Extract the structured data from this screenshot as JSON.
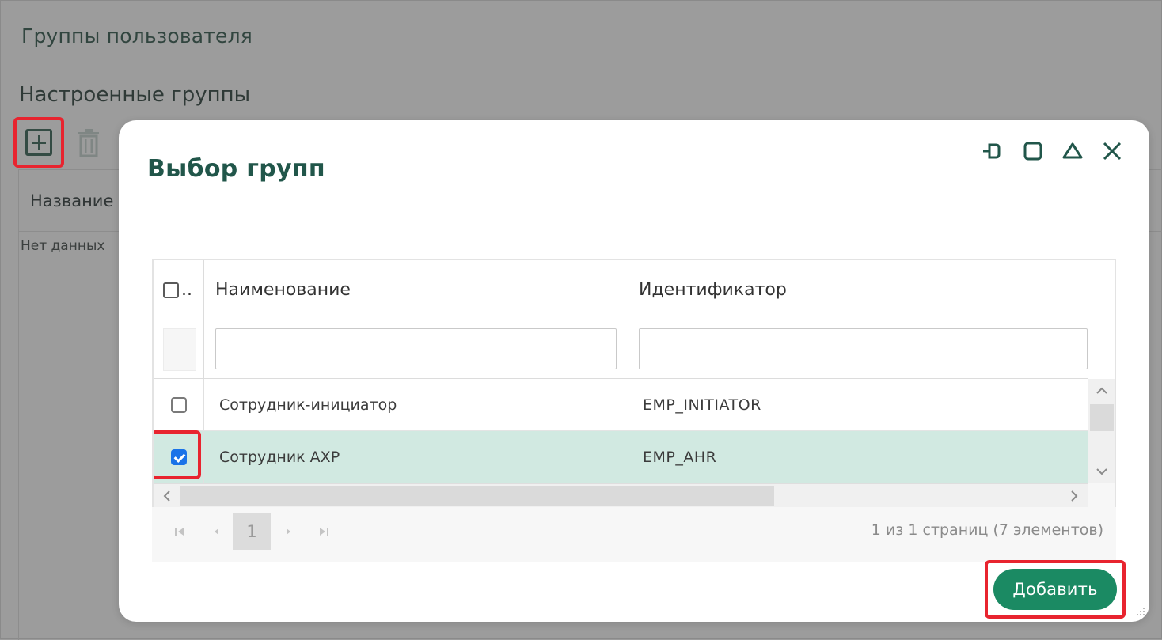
{
  "background": {
    "page_title": "Группы пользователя",
    "section_title": "Настроенные группы",
    "table_header_name": "Название",
    "empty_text": "Нет данных"
  },
  "modal": {
    "title": "Выбор групп",
    "grid": {
      "header_check": "..",
      "columns": {
        "name": "Наименование",
        "id": "Идентификатор"
      },
      "rows": [
        {
          "name": "Сотрудник-инициатор",
          "id": "EMP_INITIATOR",
          "checked": false
        },
        {
          "name": "Сотрудник АХР",
          "id": "EMP_AHR",
          "checked": true
        }
      ]
    },
    "pager": {
      "current_page": "1",
      "info": "1 из 1 страниц (7 элементов)"
    },
    "add_button_label": "Добавить"
  },
  "colors": {
    "accent_green": "#1b8a63",
    "title_green": "#21564a",
    "selected_row": "#d1e9e1",
    "highlight_red": "#e8242f"
  }
}
